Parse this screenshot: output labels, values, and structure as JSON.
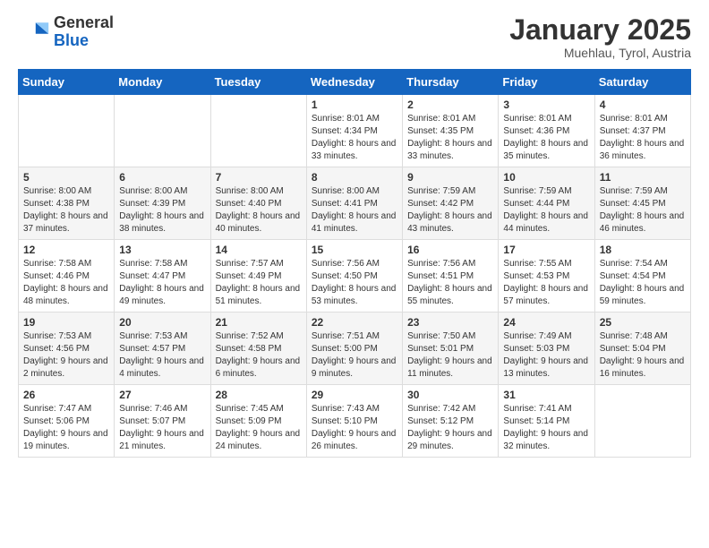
{
  "header": {
    "logo_general": "General",
    "logo_blue": "Blue",
    "month": "January 2025",
    "location": "Muehlau, Tyrol, Austria"
  },
  "days_of_week": [
    "Sunday",
    "Monday",
    "Tuesday",
    "Wednesday",
    "Thursday",
    "Friday",
    "Saturday"
  ],
  "weeks": [
    [
      {
        "day": "",
        "info": ""
      },
      {
        "day": "",
        "info": ""
      },
      {
        "day": "",
        "info": ""
      },
      {
        "day": "1",
        "info": "Sunrise: 8:01 AM\nSunset: 4:34 PM\nDaylight: 8 hours and 33 minutes."
      },
      {
        "day": "2",
        "info": "Sunrise: 8:01 AM\nSunset: 4:35 PM\nDaylight: 8 hours and 33 minutes."
      },
      {
        "day": "3",
        "info": "Sunrise: 8:01 AM\nSunset: 4:36 PM\nDaylight: 8 hours and 35 minutes."
      },
      {
        "day": "4",
        "info": "Sunrise: 8:01 AM\nSunset: 4:37 PM\nDaylight: 8 hours and 36 minutes."
      }
    ],
    [
      {
        "day": "5",
        "info": "Sunrise: 8:00 AM\nSunset: 4:38 PM\nDaylight: 8 hours and 37 minutes."
      },
      {
        "day": "6",
        "info": "Sunrise: 8:00 AM\nSunset: 4:39 PM\nDaylight: 8 hours and 38 minutes."
      },
      {
        "day": "7",
        "info": "Sunrise: 8:00 AM\nSunset: 4:40 PM\nDaylight: 8 hours and 40 minutes."
      },
      {
        "day": "8",
        "info": "Sunrise: 8:00 AM\nSunset: 4:41 PM\nDaylight: 8 hours and 41 minutes."
      },
      {
        "day": "9",
        "info": "Sunrise: 7:59 AM\nSunset: 4:42 PM\nDaylight: 8 hours and 43 minutes."
      },
      {
        "day": "10",
        "info": "Sunrise: 7:59 AM\nSunset: 4:44 PM\nDaylight: 8 hours and 44 minutes."
      },
      {
        "day": "11",
        "info": "Sunrise: 7:59 AM\nSunset: 4:45 PM\nDaylight: 8 hours and 46 minutes."
      }
    ],
    [
      {
        "day": "12",
        "info": "Sunrise: 7:58 AM\nSunset: 4:46 PM\nDaylight: 8 hours and 48 minutes."
      },
      {
        "day": "13",
        "info": "Sunrise: 7:58 AM\nSunset: 4:47 PM\nDaylight: 8 hours and 49 minutes."
      },
      {
        "day": "14",
        "info": "Sunrise: 7:57 AM\nSunset: 4:49 PM\nDaylight: 8 hours and 51 minutes."
      },
      {
        "day": "15",
        "info": "Sunrise: 7:56 AM\nSunset: 4:50 PM\nDaylight: 8 hours and 53 minutes."
      },
      {
        "day": "16",
        "info": "Sunrise: 7:56 AM\nSunset: 4:51 PM\nDaylight: 8 hours and 55 minutes."
      },
      {
        "day": "17",
        "info": "Sunrise: 7:55 AM\nSunset: 4:53 PM\nDaylight: 8 hours and 57 minutes."
      },
      {
        "day": "18",
        "info": "Sunrise: 7:54 AM\nSunset: 4:54 PM\nDaylight: 8 hours and 59 minutes."
      }
    ],
    [
      {
        "day": "19",
        "info": "Sunrise: 7:53 AM\nSunset: 4:56 PM\nDaylight: 9 hours and 2 minutes."
      },
      {
        "day": "20",
        "info": "Sunrise: 7:53 AM\nSunset: 4:57 PM\nDaylight: 9 hours and 4 minutes."
      },
      {
        "day": "21",
        "info": "Sunrise: 7:52 AM\nSunset: 4:58 PM\nDaylight: 9 hours and 6 minutes."
      },
      {
        "day": "22",
        "info": "Sunrise: 7:51 AM\nSunset: 5:00 PM\nDaylight: 9 hours and 9 minutes."
      },
      {
        "day": "23",
        "info": "Sunrise: 7:50 AM\nSunset: 5:01 PM\nDaylight: 9 hours and 11 minutes."
      },
      {
        "day": "24",
        "info": "Sunrise: 7:49 AM\nSunset: 5:03 PM\nDaylight: 9 hours and 13 minutes."
      },
      {
        "day": "25",
        "info": "Sunrise: 7:48 AM\nSunset: 5:04 PM\nDaylight: 9 hours and 16 minutes."
      }
    ],
    [
      {
        "day": "26",
        "info": "Sunrise: 7:47 AM\nSunset: 5:06 PM\nDaylight: 9 hours and 19 minutes."
      },
      {
        "day": "27",
        "info": "Sunrise: 7:46 AM\nSunset: 5:07 PM\nDaylight: 9 hours and 21 minutes."
      },
      {
        "day": "28",
        "info": "Sunrise: 7:45 AM\nSunset: 5:09 PM\nDaylight: 9 hours and 24 minutes."
      },
      {
        "day": "29",
        "info": "Sunrise: 7:43 AM\nSunset: 5:10 PM\nDaylight: 9 hours and 26 minutes."
      },
      {
        "day": "30",
        "info": "Sunrise: 7:42 AM\nSunset: 5:12 PM\nDaylight: 9 hours and 29 minutes."
      },
      {
        "day": "31",
        "info": "Sunrise: 7:41 AM\nSunset: 5:14 PM\nDaylight: 9 hours and 32 minutes."
      },
      {
        "day": "",
        "info": ""
      }
    ]
  ]
}
